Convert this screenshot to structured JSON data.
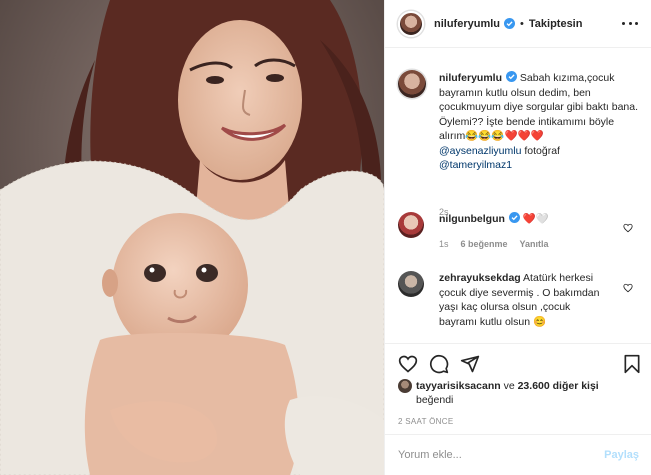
{
  "post": {
    "username": "niluferyumlu",
    "follow_status": "Takiptesin",
    "separator": "•"
  },
  "caption": {
    "username": "niluferyumlu",
    "text": " Sabah kızıma,çocuk bayramın kutlu olsun dedim, ben çocukmuyum diye sorgular gibi baktı bana. Öylemi?? İşte bende intikamımı böyle alırım😂😂😂❤️❤️❤️",
    "mention1": "@aysenazliyumlu",
    "after_mention1": " fotoğraf",
    "mention2": "@tameryilmaz1",
    "time": "2s"
  },
  "comments": [
    {
      "username": "nilgunbelgun",
      "text": " ❤️🤍",
      "time": "1s",
      "likes": "6 beğenme",
      "reply": "Yanıtla"
    },
    {
      "username": "zehrayuksekdag",
      "text": " Atatürk herkesi çocuk diye severmiş . O bakımdan yaşı kaç olursa olsun ,çocuk bayramı kutlu olsun 😊"
    }
  ],
  "likes": {
    "liker": "tayyarisiksacann",
    "connector": " ve ",
    "count_text": "23.600 diğer kişi",
    "suffix": "beğendi"
  },
  "time_ago": "2 SAAT ÖNCE",
  "comment_box": {
    "placeholder": "Yorum ekle...",
    "post_label": "Paylaş"
  },
  "colors": {
    "verified": "#3897f0",
    "text": "#262626",
    "muted": "#8e8e8e",
    "link": "#00376b",
    "post_disabled": "#b2dffc"
  },
  "icons": [
    "more-icon",
    "verified-icon",
    "heart-icon",
    "comment-icon",
    "share-icon",
    "bookmark-icon"
  ]
}
